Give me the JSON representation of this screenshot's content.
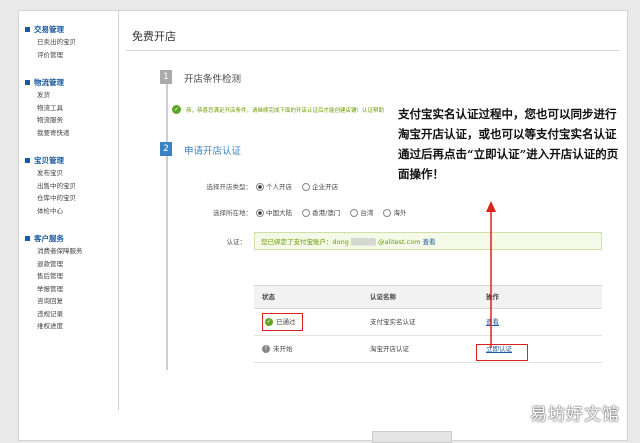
{
  "sidebar": {
    "groups": [
      {
        "title": "交易管理",
        "items": [
          "已卖出的宝贝",
          "评价管理"
        ]
      },
      {
        "title": "物流管理",
        "items": [
          "发货",
          "物流工具",
          "物流服务",
          "我要寄快递"
        ]
      },
      {
        "title": "宝贝管理",
        "items": [
          "发布宝贝",
          "出售中的宝贝",
          "仓库中的宝贝",
          "体检中心"
        ]
      },
      {
        "title": "客户服务",
        "items": [
          "消费者保障服务",
          "退款管理",
          "售后管理",
          "举报管理",
          "咨询回复",
          "违规记录",
          "维权进度"
        ]
      }
    ]
  },
  "main": {
    "title": "免费开店",
    "step1": {
      "num": "1",
      "title": "开店条件检测"
    },
    "notice": "恭，恭喜您满足开店条件，请继续完成下面的开店认证后才能创建店铺！认证帮助",
    "step2": {
      "num": "2",
      "title": "申请开店认证"
    },
    "shop_type": {
      "label": "选择开店类型：",
      "options": [
        "个人开店",
        "企业开店"
      ]
    },
    "region": {
      "label": "选择所在地：",
      "options": [
        "中国大陆",
        "香港/澳门",
        "台湾",
        "海外"
      ]
    },
    "cert": {
      "label": "认证：",
      "text": "您已绑定了支付宝账户：dong",
      "email_suffix": "@alitest.com",
      "link": "查看"
    },
    "table": {
      "headers": [
        "状态",
        "认证名称",
        "操作"
      ],
      "rows": [
        {
          "status": "已通过",
          "name": "支付宝实名认证",
          "action": "查看"
        },
        {
          "status": "未开始",
          "name": "淘宝开店认证",
          "action": "立即认证"
        }
      ]
    }
  },
  "callout": "支付宝实名认证过程中，您也可以同步进行淘宝开店认证，或也可以等支付宝实名认证通过后再点击“立即认证”进入开店认证的页面操作！",
  "watermark": "易坊好文馆",
  "colors": {
    "link": "#1b5a9f",
    "accent": "#3b82c4",
    "success": "#5fa424",
    "highlight": "#d9231c"
  }
}
